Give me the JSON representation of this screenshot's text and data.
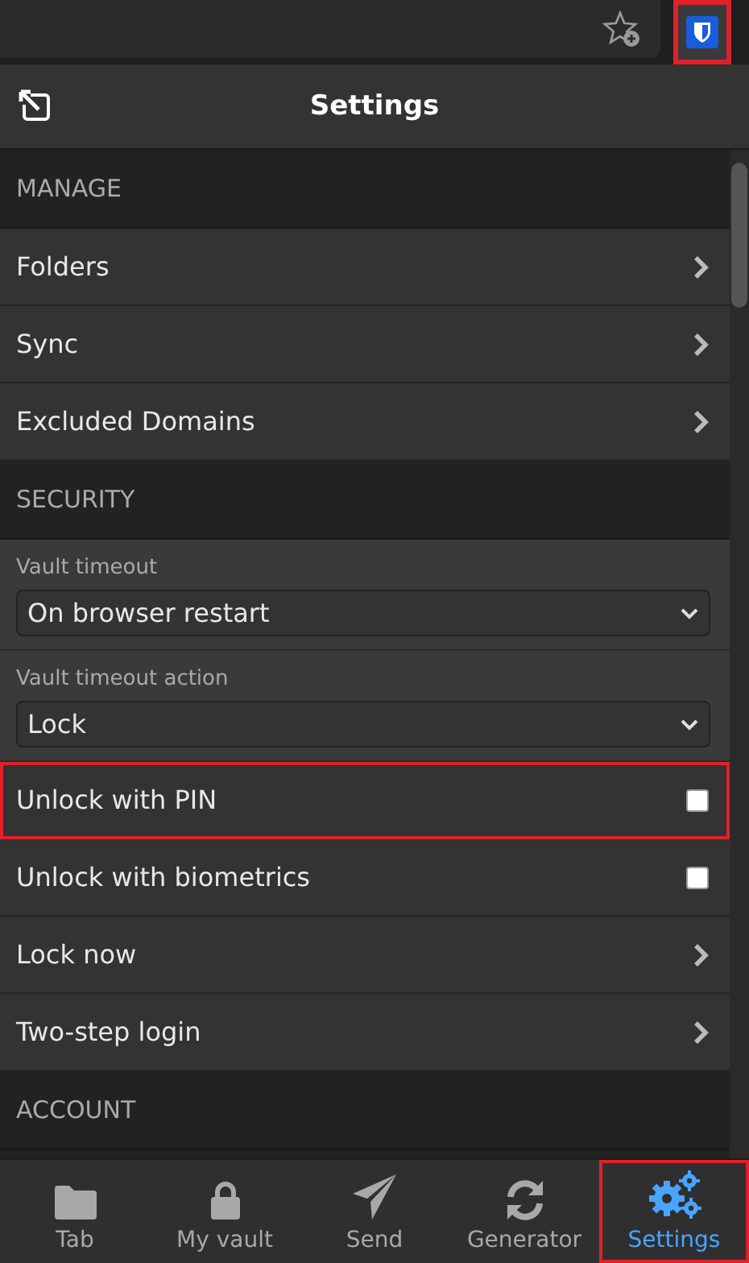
{
  "browser_bar": {
    "extension_highlighted": true
  },
  "header": {
    "title": "Settings"
  },
  "sections": [
    {
      "title": "MANAGE",
      "items": [
        {
          "kind": "link",
          "label": "Folders",
          "highlighted": false
        },
        {
          "kind": "link",
          "label": "Sync",
          "highlighted": false
        },
        {
          "kind": "link",
          "label": "Excluded Domains",
          "highlighted": false
        }
      ]
    },
    {
      "title": "SECURITY",
      "items": [
        {
          "kind": "select",
          "label": "Vault timeout",
          "value": "On browser restart",
          "highlighted": false
        },
        {
          "kind": "select",
          "label": "Vault timeout action",
          "value": "Lock",
          "highlighted": false
        },
        {
          "kind": "checkbox",
          "label": "Unlock with PIN",
          "checked": false,
          "highlighted": true
        },
        {
          "kind": "checkbox",
          "label": "Unlock with biometrics",
          "checked": false,
          "highlighted": false
        },
        {
          "kind": "link",
          "label": "Lock now",
          "highlighted": false
        },
        {
          "kind": "link",
          "label": "Two-step login",
          "highlighted": false
        }
      ]
    },
    {
      "title": "ACCOUNT"
    }
  ],
  "nav": [
    {
      "kind": "folder",
      "label": "Tab",
      "selected": false,
      "highlighted": false
    },
    {
      "kind": "lock",
      "label": "My vault",
      "selected": false,
      "highlighted": false
    },
    {
      "kind": "send",
      "label": "Send",
      "selected": false,
      "highlighted": false
    },
    {
      "kind": "sync",
      "label": "Generator",
      "selected": false,
      "highlighted": false
    },
    {
      "kind": "gears",
      "label": "Settings",
      "selected": true,
      "highlighted": true
    }
  ]
}
